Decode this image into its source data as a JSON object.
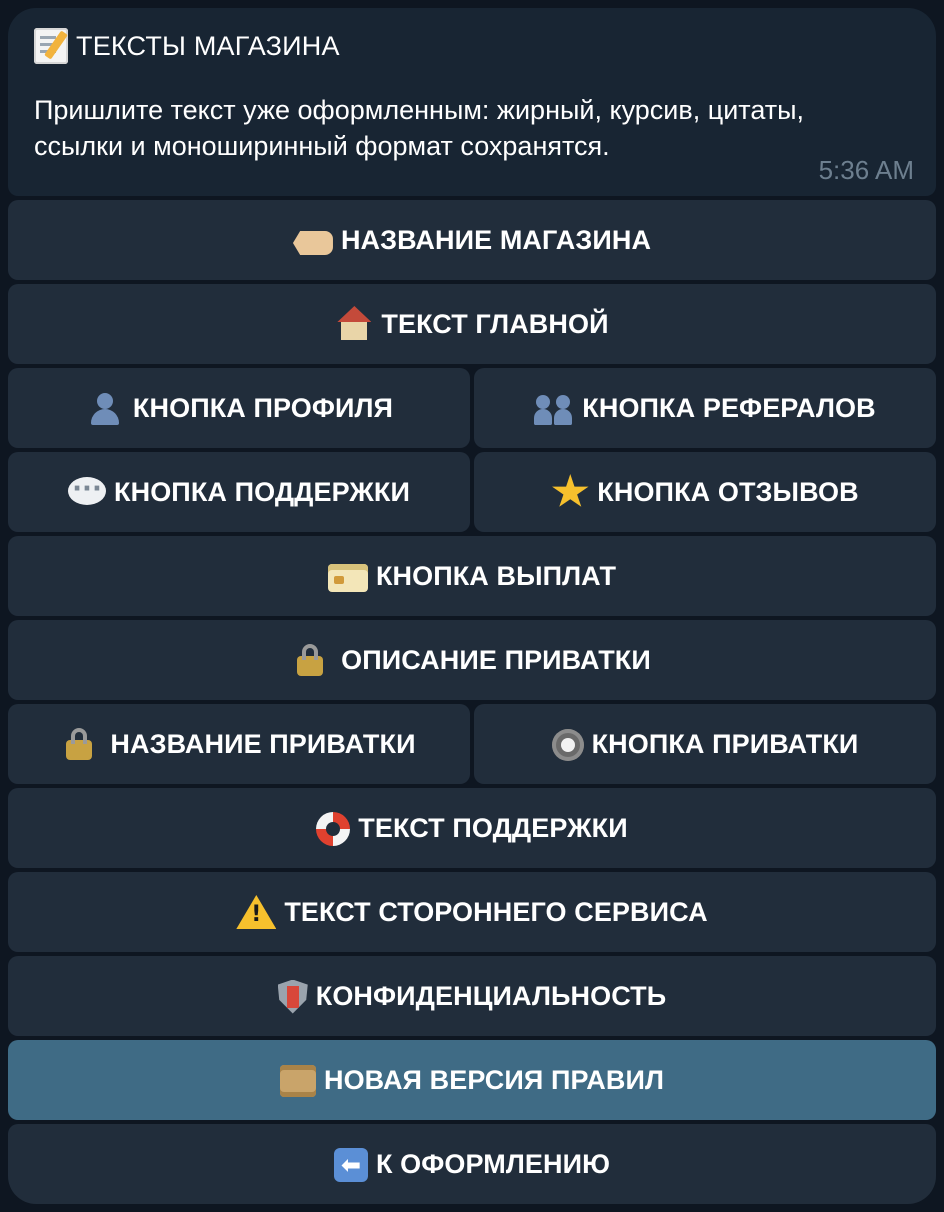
{
  "message": {
    "title_icon": "memo-icon",
    "title": "ТЕКСТЫ МАГАЗИНА",
    "text": "Пришлите текст уже оформленным: жирный, курсив, цитаты, ссылки и моноширинный формат сохранятся.",
    "time": "5:36 AM"
  },
  "keyboard": {
    "rows": [
      [
        {
          "icon": "label-tag-icon",
          "label": "НАЗВАНИЕ МАГАЗИНА"
        }
      ],
      [
        {
          "icon": "house-icon",
          "label": "ТЕКСТ ГЛАВНОЙ"
        }
      ],
      [
        {
          "icon": "user-icon",
          "label": "КНОПКА ПРОФИЛЯ"
        },
        {
          "icon": "users-icon",
          "label": "КНОПКА РЕФЕРАЛОВ"
        }
      ],
      [
        {
          "icon": "speech-bubble-icon",
          "label": "КНОПКА ПОДДЕРЖКИ"
        },
        {
          "icon": "star-icon",
          "label": "КНОПКА ОТЗЫВОВ"
        }
      ],
      [
        {
          "icon": "credit-card-icon",
          "label": "КНОПКА ВЫПЛАТ"
        }
      ],
      [
        {
          "icon": "lock-key-icon",
          "label": "ОПИСАНИЕ ПРИВАТКИ"
        }
      ],
      [
        {
          "icon": "lock-key-icon",
          "label": "НАЗВАНИЕ ПРИВАТКИ"
        },
        {
          "icon": "radio-button-icon",
          "label": "КНОПКА ПРИВАТКИ"
        }
      ],
      [
        {
          "icon": "life-buoy-icon",
          "label": "ТЕКСТ ПОДДЕРЖКИ"
        }
      ],
      [
        {
          "icon": "warning-icon",
          "label": "ТЕКСТ СТОРОННЕГО СЕРВИСА"
        }
      ],
      [
        {
          "icon": "shield-icon",
          "label": "КОНФИДЕНЦИАЛЬНОСТЬ"
        }
      ],
      [
        {
          "icon": "scroll-icon",
          "label": "НОВАЯ ВЕРСИЯ ПРАВИЛ",
          "active": true
        }
      ],
      [
        {
          "icon": "back-arrow-icon",
          "label": "К ОФОРМЛЕНИЮ"
        }
      ]
    ]
  },
  "colors": {
    "background": "#0e1621",
    "bubble": "#182533",
    "button": "#212d3b",
    "button_active": "#3f6b85",
    "time_text": "#6d7f8f"
  }
}
